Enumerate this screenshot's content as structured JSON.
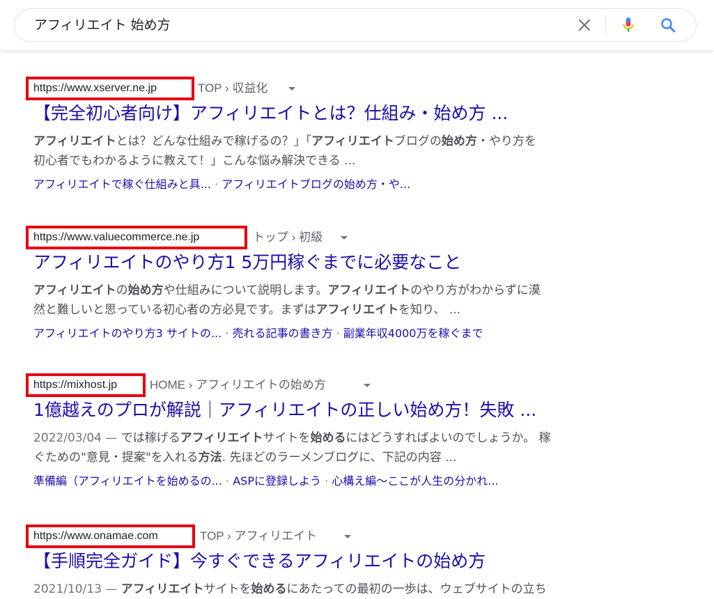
{
  "search": {
    "query": "アフィリエイト 始め方",
    "icons": [
      "clear-icon",
      "mic-icon",
      "search-icon"
    ],
    "accent": "#4285f4"
  },
  "results": [
    {
      "url": "https://www.xserver.ne.jp",
      "breadcrumb": "TOP › 収益化",
      "title": "【完全初心者向け】アフィリエイトとは？仕組み・始め方 ...",
      "snippet_lines": [
        [
          {
            "t": "アフィリエイト",
            "b": true
          },
          {
            "t": "とは？どんな仕組みで稼げるの？」「"
          },
          {
            "t": "アフィリエイト",
            "b": true
          },
          {
            "t": "ブログの"
          },
          {
            "t": "始め方",
            "b": true
          },
          {
            "t": "・やり方を"
          }
        ],
        [
          {
            "t": "初心者でもわかるように教えて！」こんな悩み解決できる ..."
          }
        ]
      ],
      "sitelinks": [
        "アフィリエイトで稼ぐ仕組みと具...",
        "アフィリエイトブログの始め方・や..."
      ]
    },
    {
      "url": "https://www.valuecommerce.ne.jp",
      "breadcrumb": "トップ › 初級",
      "title": "アフィリエイトのやり方1 5万円稼ぐまでに必要なこと",
      "snippet_lines": [
        [
          {
            "t": "アフィリエイト",
            "b": true
          },
          {
            "t": "の"
          },
          {
            "t": "始め方",
            "b": true
          },
          {
            "t": "や仕組みについて説明します。"
          },
          {
            "t": "アフィリエイト",
            "b": true
          },
          {
            "t": "のやり方がわからずに漠"
          }
        ],
        [
          {
            "t": "然と難しいと思っている初心者の方必見です。まずは"
          },
          {
            "t": "アフィリエイト",
            "b": true
          },
          {
            "t": "を知り、 ..."
          }
        ]
      ],
      "sitelinks": [
        "アフィリエイトのやり方3 サイトの...",
        "売れる記事の書き方",
        "副業年収4000万を稼ぐまで"
      ]
    },
    {
      "url": "https://mixhost.jp",
      "breadcrumb": "HOME › アフィリエイトの始め方",
      "title": "1億越えのプロが解説｜アフィリエイトの正しい始め方！失敗 ...",
      "snippet_lines": [
        [
          {
            "t": "2022/03/04 — ",
            "d": true
          },
          {
            "t": "では稼げる"
          },
          {
            "t": "アフィリエイト",
            "b": true
          },
          {
            "t": "サイトを"
          },
          {
            "t": "始める",
            "b": true
          },
          {
            "t": "にはどうすればよいのでしょうか。 稼"
          }
        ],
        [
          {
            "t": "ぐための\"意見・提案\"を入れる"
          },
          {
            "t": "方法",
            "b": true
          },
          {
            "t": ". 先ほどのラーメンブログに、下記の内容 ..."
          }
        ]
      ],
      "sitelinks": [
        "準備編（アフィリエイトを始めるの...",
        "ASPに登録しよう",
        "心構え編〜ここが人生の分かれ..."
      ]
    },
    {
      "url": "https://www.onamae.com",
      "breadcrumb": "TOP › アフィリエイト",
      "title": "【手順完全ガイド】今すぐできるアフィリエイトの始め方",
      "snippet_lines": [
        [
          {
            "t": "2021/10/13 — ",
            "d": true
          },
          {
            "t": "アフィリエイト",
            "b": true
          },
          {
            "t": "サイトを"
          },
          {
            "t": "始める",
            "b": true
          },
          {
            "t": "にあたっての最初の一歩は、ウェブサイトの立ち"
          }
        ]
      ],
      "sitelinks": []
    }
  ]
}
